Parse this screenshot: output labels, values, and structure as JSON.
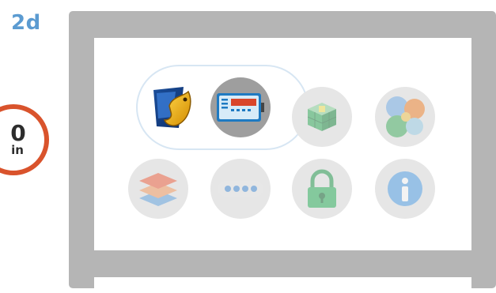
{
  "step": {
    "label": "2d"
  },
  "timer": {
    "number": "0",
    "unit": "in"
  },
  "colors": {
    "step_label": "#5b9bd1",
    "timer_ring": "#d9532c",
    "monitor_frame": "#b5b5b5",
    "selection_outline": "#d7e6f3"
  },
  "apps": [
    {
      "icon": "ftp-client-icon",
      "state": "selected"
    },
    {
      "icon": "card-reader-icon",
      "state": "selected"
    },
    {
      "icon": "3d-cube-icon",
      "state": "faded"
    },
    {
      "icon": "puzzle-pieces-icon",
      "state": "faded"
    },
    {
      "icon": "layers-icon",
      "state": "faded"
    },
    {
      "icon": "password-icon",
      "state": "faded"
    },
    {
      "icon": "lock-icon",
      "state": "faded"
    },
    {
      "icon": "info-icon",
      "state": "faded"
    }
  ]
}
